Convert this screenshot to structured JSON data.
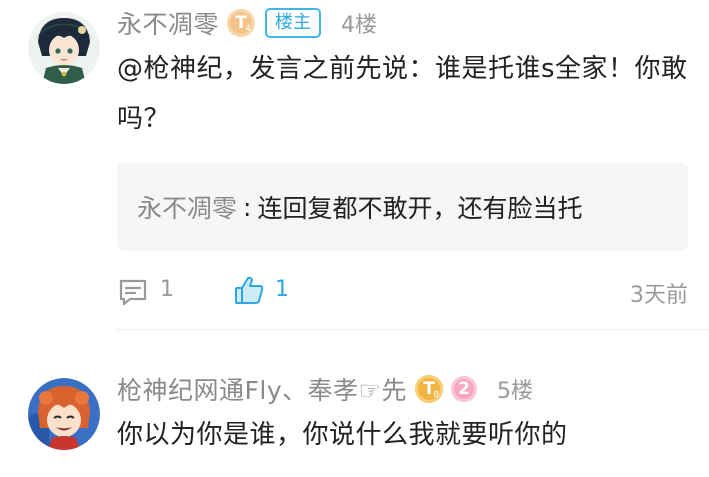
{
  "posts": [
    {
      "username": "永不凋零",
      "level_badge_text": "T",
      "level_badge_num": "4",
      "owner_label": "楼主",
      "floor": "4楼",
      "content": "@枪神纪，发言之前先说：谁是托谁s全家！你敢吗？",
      "quote": {
        "name": "永不凋零",
        "separator": ":",
        "text": "连回复都不敢开，还有脸当托"
      },
      "comment_count": "1",
      "like_count": "1",
      "time": "3天前"
    },
    {
      "username": "枪神纪网通Fly、奉孝☞先",
      "level_badge_text": "T",
      "level_badge_num": "8",
      "pink_badge": "2",
      "floor": "5楼",
      "content": "你以为你是谁，你说什么我就要听你的"
    }
  ],
  "icons": {
    "comment": "comment-icon",
    "like": "thumbs-up-icon"
  },
  "colors": {
    "accent": "#2fa7e0",
    "meta_text": "#9a9a9a",
    "badge_orange": "#f3c48a",
    "badge_gold": "#f2b544",
    "badge_pink": "#f7a8c0"
  }
}
